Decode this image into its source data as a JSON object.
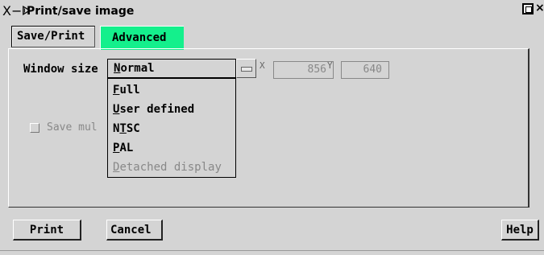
{
  "window": {
    "logo": "X−ᐈ",
    "title": "Print/save image",
    "close_glyph": "×"
  },
  "tabs": [
    {
      "label": "Save/Print",
      "active": false
    },
    {
      "label": "Advanced",
      "active": true
    }
  ],
  "accent_color": "#14f08c",
  "window_size": {
    "label": "Window size",
    "selected_first": "N",
    "selected_rest": "ormal",
    "x_label": "X",
    "x_value": "856",
    "y_label": "Y",
    "y_value": "640"
  },
  "dropdown": {
    "items": [
      {
        "mnemonic": "F",
        "rest": "ull",
        "enabled": true
      },
      {
        "mnemonic": "U",
        "rest": "ser defined",
        "enabled": true
      },
      {
        "pre": "N",
        "mnemonic": "T",
        "rest": "SC",
        "enabled": true
      },
      {
        "mnemonic": "P",
        "rest": "AL",
        "enabled": true
      },
      {
        "mnemonic": "D",
        "rest": "etached display",
        "enabled": false
      }
    ]
  },
  "checkbox": {
    "label": "Save mul",
    "checked": false,
    "enabled": false
  },
  "buttons": {
    "print": "Print",
    "cancel": "Cancel",
    "help": "Help"
  }
}
